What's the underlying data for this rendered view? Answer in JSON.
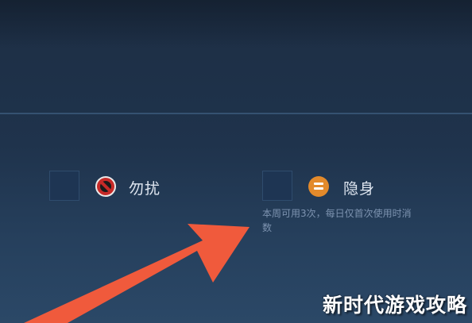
{
  "options": [
    {
      "id": "do-not-disturb",
      "label": "勿扰",
      "checked": false,
      "icon": "no-entry-icon",
      "icon_color": "#c62a28"
    },
    {
      "id": "invisible",
      "label": "隐身",
      "checked": false,
      "icon": "equals-icon",
      "icon_color": "#e38a2b",
      "hint_line1": "本周可用3次，每日仅首次使用时消",
      "hint_line2": "数"
    }
  ],
  "annotation": {
    "arrow_color": "#f05a3c"
  },
  "watermark": {
    "text": "新时代游戏攻略"
  },
  "colors": {
    "background": "#223852",
    "label_text": "#dfe6f0",
    "hint_text": "#7d93b0"
  }
}
